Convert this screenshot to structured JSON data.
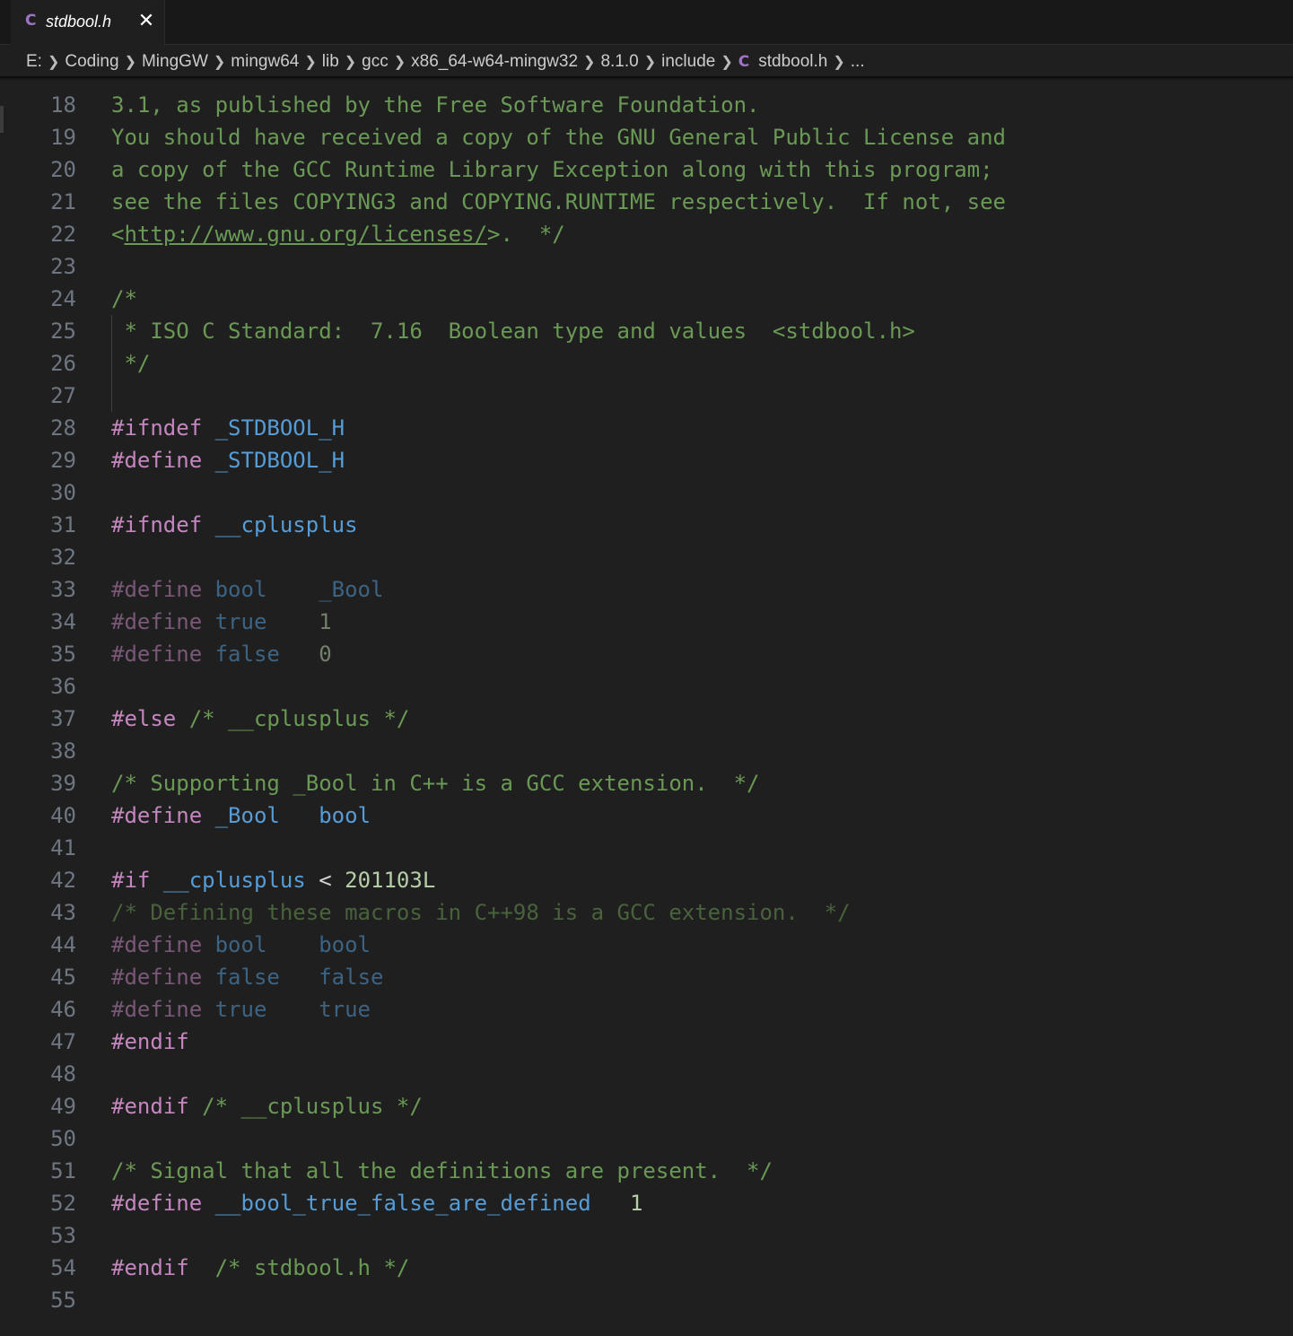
{
  "tab": {
    "icon": "C",
    "label": "stdbool.h",
    "close": "✕"
  },
  "breadcrumb": {
    "items": [
      "E:",
      "Coding",
      "MingGW",
      "mingw64",
      "lib",
      "gcc",
      "x86_64-w64-mingw32",
      "8.1.0",
      "include"
    ],
    "file_icon": "C",
    "file": "stdbool.h",
    "more": "..."
  },
  "editor": {
    "partial_top_line": "3.1, as published by the Free Software Foundation.",
    "lines": [
      {
        "n": "18",
        "segs": []
      },
      {
        "n": "19",
        "segs": [
          {
            "t": "You should have received a copy of the GNU General Public License and",
            "c": "comment"
          }
        ]
      },
      {
        "n": "20",
        "segs": [
          {
            "t": "a copy of the GCC Runtime Library Exception along with this program;",
            "c": "comment"
          }
        ]
      },
      {
        "n": "21",
        "segs": [
          {
            "t": "see the files COPYING3 and COPYING.RUNTIME respectively.  If not, see",
            "c": "comment"
          }
        ]
      },
      {
        "n": "22",
        "segs": [
          {
            "t": "<",
            "c": "comment"
          },
          {
            "t": "http://www.gnu.org/licenses/",
            "c": "comment link"
          },
          {
            "t": ">.  */",
            "c": "comment"
          }
        ]
      },
      {
        "n": "23",
        "segs": []
      },
      {
        "n": "24",
        "segs": [
          {
            "t": "/*",
            "c": "comment"
          }
        ]
      },
      {
        "n": "25",
        "segs": [
          {
            "t": " * ISO C Standard:  7.16  Boolean type and values  <stdbool.h>",
            "c": "comment"
          }
        ]
      },
      {
        "n": "26",
        "segs": [
          {
            "t": " */",
            "c": "comment"
          }
        ]
      },
      {
        "n": "27",
        "segs": []
      },
      {
        "n": "28",
        "segs": [
          {
            "t": "#ifndef",
            "c": "prep"
          },
          {
            "t": " ",
            "c": "text"
          },
          {
            "t": "_STDBOOL_H",
            "c": "macro"
          }
        ]
      },
      {
        "n": "29",
        "segs": [
          {
            "t": "#define",
            "c": "prep"
          },
          {
            "t": " ",
            "c": "text"
          },
          {
            "t": "_STDBOOL_H",
            "c": "macro"
          }
        ]
      },
      {
        "n": "30",
        "segs": []
      },
      {
        "n": "31",
        "segs": [
          {
            "t": "#ifndef",
            "c": "prep"
          },
          {
            "t": " ",
            "c": "text"
          },
          {
            "t": "__cplusplus",
            "c": "macro"
          }
        ]
      },
      {
        "n": "32",
        "segs": []
      },
      {
        "n": "33",
        "segs": [
          {
            "t": "#define",
            "c": "prep dim"
          },
          {
            "t": " ",
            "c": "text"
          },
          {
            "t": "bool",
            "c": "macro dim"
          },
          {
            "t": "    ",
            "c": "text"
          },
          {
            "t": "_Bool",
            "c": "macro dim"
          }
        ]
      },
      {
        "n": "34",
        "segs": [
          {
            "t": "#define",
            "c": "prep dim"
          },
          {
            "t": " ",
            "c": "text"
          },
          {
            "t": "true",
            "c": "macro dim"
          },
          {
            "t": "    ",
            "c": "text"
          },
          {
            "t": "1",
            "c": "num dim"
          }
        ]
      },
      {
        "n": "35",
        "segs": [
          {
            "t": "#define",
            "c": "prep dim"
          },
          {
            "t": " ",
            "c": "text"
          },
          {
            "t": "false",
            "c": "macro dim"
          },
          {
            "t": "   ",
            "c": "text"
          },
          {
            "t": "0",
            "c": "num dim"
          }
        ]
      },
      {
        "n": "36",
        "segs": []
      },
      {
        "n": "37",
        "segs": [
          {
            "t": "#else",
            "c": "prep"
          },
          {
            "t": " /* __cplusplus */",
            "c": "comment"
          }
        ]
      },
      {
        "n": "38",
        "segs": []
      },
      {
        "n": "39",
        "segs": [
          {
            "t": "/* Supporting _Bool in C++ is a GCC extension.  */",
            "c": "comment"
          }
        ]
      },
      {
        "n": "40",
        "segs": [
          {
            "t": "#define",
            "c": "prep"
          },
          {
            "t": " ",
            "c": "text"
          },
          {
            "t": "_Bool",
            "c": "macro"
          },
          {
            "t": "   ",
            "c": "text"
          },
          {
            "t": "bool",
            "c": "macro"
          }
        ]
      },
      {
        "n": "41",
        "segs": []
      },
      {
        "n": "42",
        "segs": [
          {
            "t": "#if",
            "c": "prep"
          },
          {
            "t": " ",
            "c": "text"
          },
          {
            "t": "__cplusplus",
            "c": "macro"
          },
          {
            "t": " < ",
            "c": "text"
          },
          {
            "t": "201103L",
            "c": "num"
          }
        ]
      },
      {
        "n": "43",
        "segs": [
          {
            "t": "/* Defining these macros in C++98 is a GCC extension.  */",
            "c": "comment dim"
          }
        ]
      },
      {
        "n": "44",
        "segs": [
          {
            "t": "#define",
            "c": "prep dim"
          },
          {
            "t": " ",
            "c": "text"
          },
          {
            "t": "bool",
            "c": "macro dim"
          },
          {
            "t": "    ",
            "c": "text"
          },
          {
            "t": "bool",
            "c": "macro dim"
          }
        ]
      },
      {
        "n": "45",
        "segs": [
          {
            "t": "#define",
            "c": "prep dim"
          },
          {
            "t": " ",
            "c": "text"
          },
          {
            "t": "false",
            "c": "macro dim"
          },
          {
            "t": "   ",
            "c": "text"
          },
          {
            "t": "false",
            "c": "macro dim"
          }
        ]
      },
      {
        "n": "46",
        "segs": [
          {
            "t": "#define",
            "c": "prep dim"
          },
          {
            "t": " ",
            "c": "text"
          },
          {
            "t": "true",
            "c": "macro dim"
          },
          {
            "t": "    ",
            "c": "text"
          },
          {
            "t": "true",
            "c": "macro dim"
          }
        ]
      },
      {
        "n": "47",
        "segs": [
          {
            "t": "#endif",
            "c": "prep"
          }
        ]
      },
      {
        "n": "48",
        "segs": []
      },
      {
        "n": "49",
        "segs": [
          {
            "t": "#endif",
            "c": "prep"
          },
          {
            "t": " /* __cplusplus */",
            "c": "comment"
          }
        ]
      },
      {
        "n": "50",
        "segs": []
      },
      {
        "n": "51",
        "segs": [
          {
            "t": "/* Signal that all the definitions are present.  */",
            "c": "comment"
          }
        ]
      },
      {
        "n": "52",
        "segs": [
          {
            "t": "#define",
            "c": "prep"
          },
          {
            "t": " ",
            "c": "text"
          },
          {
            "t": "__bool_true_false_are_defined",
            "c": "macro"
          },
          {
            "t": "   ",
            "c": "text"
          },
          {
            "t": "1",
            "c": "num"
          }
        ]
      },
      {
        "n": "53",
        "segs": []
      },
      {
        "n": "54",
        "segs": [
          {
            "t": "#endif",
            "c": "prep"
          },
          {
            "t": "  /* stdbool.h */",
            "c": "comment"
          }
        ]
      },
      {
        "n": "55",
        "segs": []
      }
    ]
  },
  "colors": {
    "background": "#1f1f1f",
    "comment": "#6a9955",
    "preprocessor": "#c586c0",
    "macro": "#569cd6",
    "number": "#b5cea8",
    "line_number": "#6e7681",
    "c_icon": "#a074c4"
  }
}
